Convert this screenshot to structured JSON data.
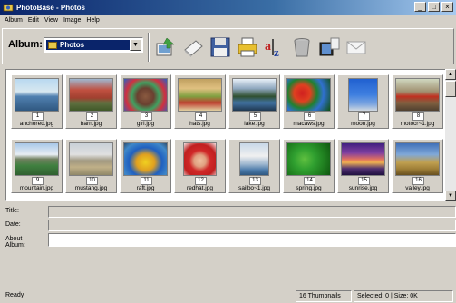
{
  "window": {
    "title": "PhotoBase - Photos",
    "minimize": "_",
    "maximize": "□",
    "close": "×"
  },
  "menu": [
    "Album",
    "Edit",
    "View",
    "Image",
    "Help"
  ],
  "toolbar": {
    "album_label": "Album:",
    "album_value": "Photos"
  },
  "thumbnails": [
    {
      "n": "1",
      "file": "anchored.jpg"
    },
    {
      "n": "2",
      "file": "barn.jpg"
    },
    {
      "n": "3",
      "file": "girl.jpg"
    },
    {
      "n": "4",
      "file": "hats.jpg"
    },
    {
      "n": "5",
      "file": "lake.jpg"
    },
    {
      "n": "6",
      "file": "macaws.jpg"
    },
    {
      "n": "7",
      "file": "moon.jpg"
    },
    {
      "n": "8",
      "file": "motocr~1.jpg"
    },
    {
      "n": "9",
      "file": "mountain.jpg"
    },
    {
      "n": "10",
      "file": "mustang.jpg"
    },
    {
      "n": "11",
      "file": "raft.jpg"
    },
    {
      "n": "12",
      "file": "redhat.jpg"
    },
    {
      "n": "13",
      "file": "sailbo~1.jpg"
    },
    {
      "n": "14",
      "file": "spring.jpg"
    },
    {
      "n": "15",
      "file": "sunrise.jpg"
    },
    {
      "n": "16",
      "file": "valley.jpg"
    }
  ],
  "fields": {
    "title_label": "Title:",
    "date_label": "Date:",
    "about_label": "About Album:"
  },
  "status": {
    "ready": "Ready",
    "thumbnails": "16 Thumbnails",
    "selected": "Selected: 0  |  Size: 0K"
  }
}
